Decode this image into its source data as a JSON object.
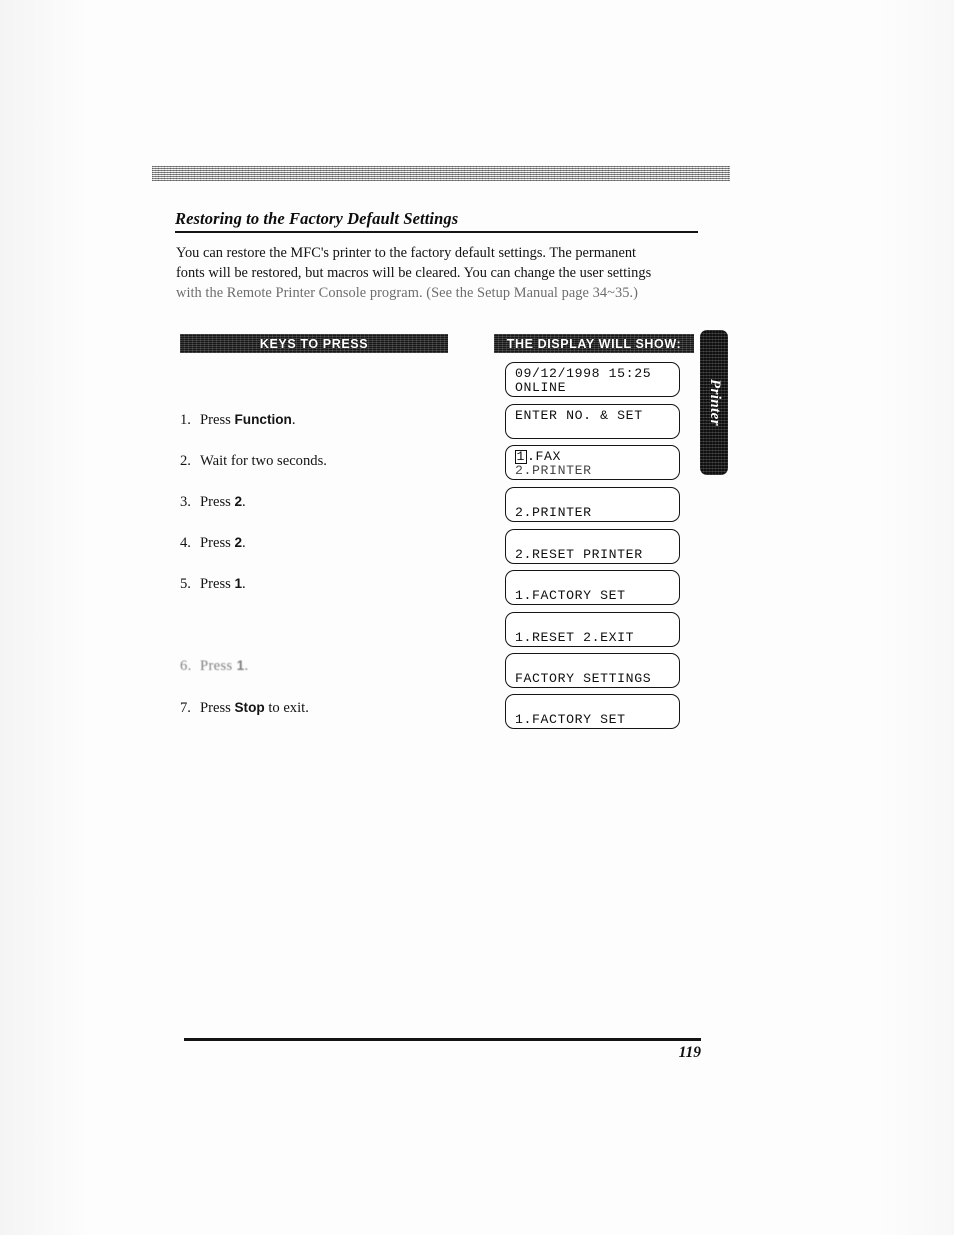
{
  "document": {
    "heading": "Restoring to the Factory Default Settings",
    "intro_lines": [
      "You can restore the MFC's printer to the factory default settings. The permanent",
      "fonts will be restored, but macros will be cleared. You can change the user settings",
      "with the Remote Printer Console program. (See the Setup Manual page 34~35.)"
    ],
    "page_number": "119",
    "side_tab_label": "Printer"
  },
  "columns": {
    "keys_header": "KEYS TO PRESS",
    "display_header": "THE DISPLAY WILL SHOW:"
  },
  "steps": [
    {
      "num": "1.",
      "text_before": "Press ",
      "key": "Function",
      "text_after": "."
    },
    {
      "num": "2.",
      "text_before": "Wait for two seconds.",
      "key": "",
      "text_after": ""
    },
    {
      "num": "3.",
      "text_before": "Press ",
      "key": "2",
      "text_after": "."
    },
    {
      "num": "4.",
      "text_before": "Press ",
      "key": "2",
      "text_after": "."
    },
    {
      "num": "5.",
      "text_before": "Press ",
      "key": "1",
      "text_after": "."
    },
    {
      "num": "6.",
      "text_before": "Press ",
      "key": "1",
      "text_after": "."
    },
    {
      "num": "7.",
      "text_before": "Press ",
      "key": "Stop",
      "text_after": " to exit."
    }
  ],
  "displays": [
    {
      "line1": "09/12/1998 15:25",
      "line2": "ONLINE"
    },
    {
      "line1": "ENTER NO. & SET",
      "line2": ""
    },
    {
      "line1": "1.FAX",
      "line2": "2.PRINTER",
      "cursor_char": "1",
      "line1_rest": ".FAX"
    },
    {
      "line1": "",
      "line2": "2.PRINTER"
    },
    {
      "line1": "",
      "line2": "2.RESET PRINTER"
    },
    {
      "line1": "",
      "line2": "1.FACTORY SET"
    },
    {
      "line1": "",
      "line2": "1.RESET 2.EXIT"
    },
    {
      "line1": "",
      "line2": "FACTORY SETTINGS"
    },
    {
      "line1": "",
      "line2": "1.FACTORY SET"
    }
  ]
}
